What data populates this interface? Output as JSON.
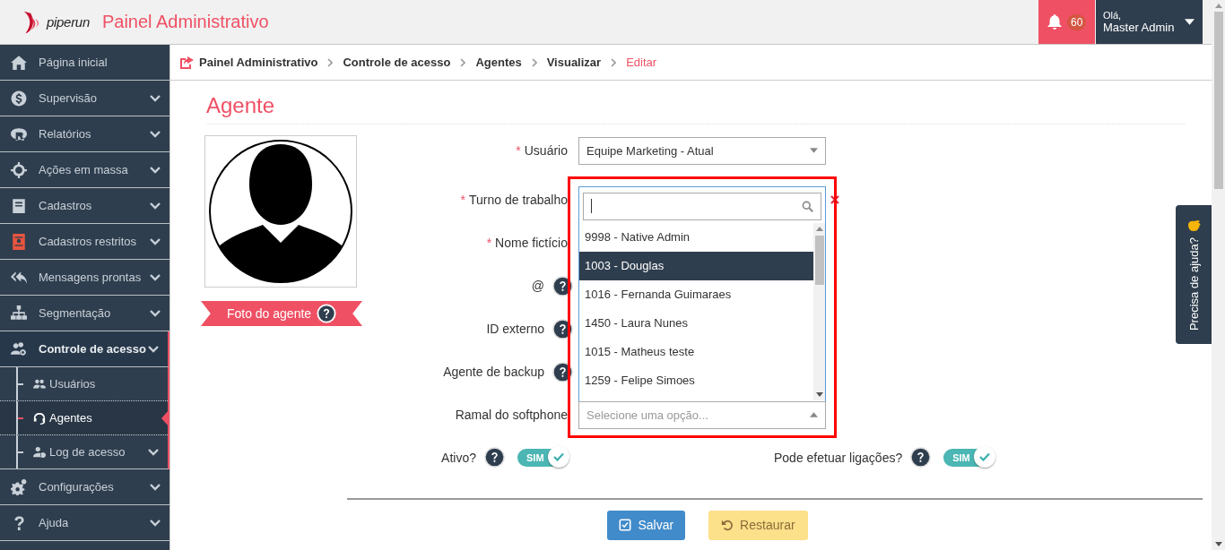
{
  "header": {
    "logo": "piperun",
    "title": "Painel Administrativo",
    "notifications": "60",
    "greeting": "Olá,",
    "user": "Master Admin"
  },
  "sidebar": {
    "items": [
      {
        "label": "Página inicial",
        "expandable": false,
        "expanded": false
      },
      {
        "label": "Supervisão",
        "expandable": true,
        "expanded": false
      },
      {
        "label": "Relatórios",
        "expandable": true,
        "expanded": false
      },
      {
        "label": "Ações em massa",
        "expandable": true,
        "expanded": false
      },
      {
        "label": "Cadastros",
        "expandable": true,
        "expanded": false
      },
      {
        "label": "Cadastros restritos",
        "expandable": true,
        "expanded": false
      },
      {
        "label": "Mensagens prontas",
        "expandable": true,
        "expanded": false
      },
      {
        "label": "Segmentação",
        "expandable": true,
        "expanded": false
      },
      {
        "label": "Controle de acesso",
        "expandable": true,
        "expanded": true,
        "children": [
          {
            "label": "Usuários",
            "expandable": false,
            "selected": false
          },
          {
            "label": "Agentes",
            "expandable": false,
            "selected": true
          },
          {
            "label": "Log de acesso",
            "expandable": true,
            "selected": false
          }
        ]
      },
      {
        "label": "Configurações",
        "expandable": true,
        "expanded": false
      },
      {
        "label": "Ajuda",
        "expandable": true,
        "expanded": false
      }
    ]
  },
  "breadcrumb": [
    {
      "label": "Painel Administrativo",
      "current": false
    },
    {
      "label": "Controle de acesso",
      "current": false
    },
    {
      "label": "Agentes",
      "current": false
    },
    {
      "label": "Visualizar",
      "current": false
    },
    {
      "label": "Editar",
      "current": true
    }
  ],
  "page_title": "Agente",
  "photo": {
    "label": "Foto do agente"
  },
  "form": {
    "fields": [
      {
        "label": "Usuário",
        "required_mark": "*",
        "kind": "select",
        "value": "Equipe Marketing - Atual"
      },
      {
        "label": "Turno de trabalho",
        "required_mark": "*",
        "kind": "hidden"
      },
      {
        "label": "Nome fictício",
        "required_mark": "*",
        "kind": "hidden"
      },
      {
        "label": "@",
        "help": true,
        "kind": "hidden"
      },
      {
        "label": "ID externo",
        "help": true,
        "kind": "hidden"
      },
      {
        "label": "Agente de backup",
        "help": true,
        "kind": "hidden"
      },
      {
        "label": "Ramal do softphone",
        "kind": "dropdown",
        "placeholder": "Selecione uma opção...",
        "open": true,
        "options": [
          {
            "label": "9998 - Native Admin",
            "selected": false
          },
          {
            "label": "1003 - Douglas",
            "selected": true
          },
          {
            "label": "1016 - Fernanda Guimaraes",
            "selected": false
          },
          {
            "label": "1450 - Laura Nunes",
            "selected": false
          },
          {
            "label": "1015 - Matheus teste",
            "selected": false
          },
          {
            "label": "1259 - Felipe Simoes",
            "selected": false
          }
        ]
      }
    ],
    "toggles": [
      {
        "label": "Ativo?",
        "on": true,
        "text": "SIM"
      },
      {
        "label": "Pode efetuar ligações?",
        "on": true,
        "text": "SIM"
      }
    ]
  },
  "buttons": [
    {
      "label": "Salvar",
      "kind": "primary"
    },
    {
      "label": "Restaurar",
      "kind": "warning"
    }
  ],
  "help_tab": {
    "label": "Precisa de ajuda?"
  }
}
